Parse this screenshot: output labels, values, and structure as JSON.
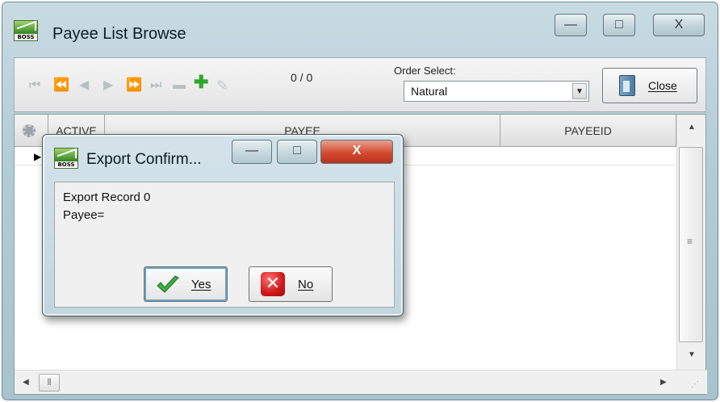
{
  "main_window": {
    "title": "Payee List Browse",
    "controls": {
      "minimize": "—",
      "maximize": "□",
      "close": "X"
    },
    "app_icon_text": "BOSS"
  },
  "toolbar": {
    "record_count": "0 / 0",
    "order_select_label": "Order Select:",
    "order_select_value": "Natural",
    "close_label": "Close"
  },
  "grid": {
    "columns": [
      "ACTIVE",
      "PAYEE",
      "PAYEEID"
    ],
    "rows": []
  },
  "dialog": {
    "title": "Export Confirm...",
    "message_line1": "Export Record 0",
    "message_line2": "Payee=",
    "yes_label": "Yes",
    "no_label": "No",
    "controls": {
      "minimize": "—",
      "maximize": "□",
      "close": "X"
    }
  }
}
